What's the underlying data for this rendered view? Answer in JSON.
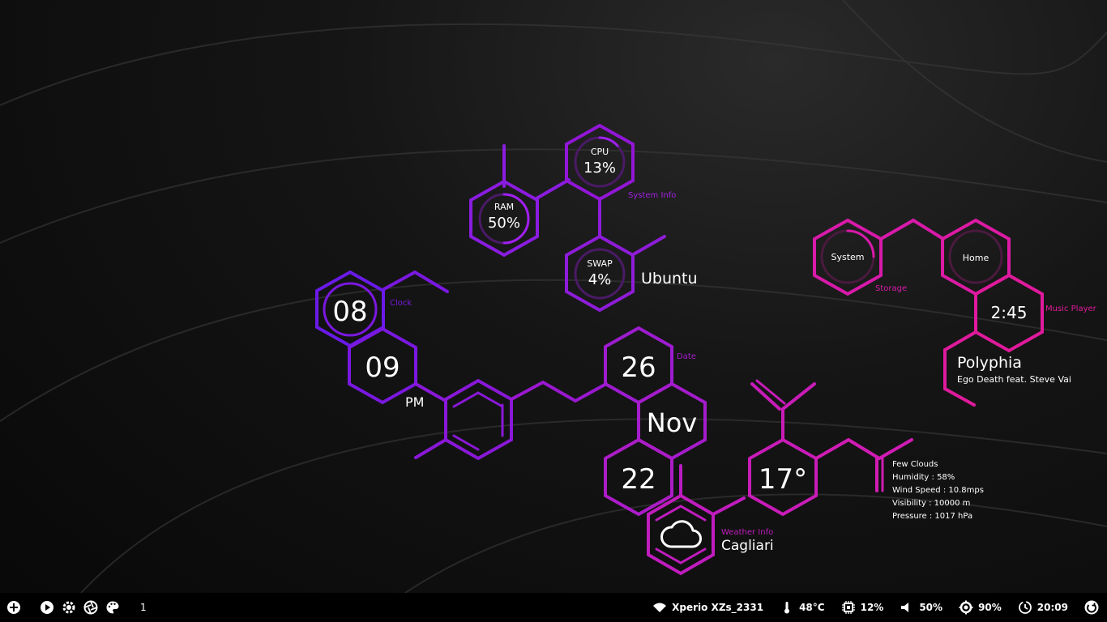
{
  "colors": {
    "purple": "#7a18e0",
    "violet": "#9d1ed6",
    "magenta": "#c91ac4",
    "pink": "#e01a9a",
    "bar": "#000000"
  },
  "system_info": {
    "label": "System Info",
    "cpu": {
      "label": "CPU",
      "value": "13%"
    },
    "ram": {
      "label": "RAM",
      "value": "50%"
    },
    "swap": {
      "label": "SWAP",
      "value": "4%"
    },
    "os": "Ubuntu"
  },
  "clock": {
    "label": "Clock",
    "hour": "08",
    "minute": "09",
    "ampm": "PM"
  },
  "date": {
    "label": "Date",
    "day": "26",
    "month": "Nov",
    "year": "22"
  },
  "weather": {
    "label": "Weather Info",
    "city": "Cagliari",
    "temp": "17°",
    "icon": "cloud-icon",
    "details": [
      "Few Clouds",
      "Humidity : 58%",
      "Wind Speed : 10.8mps",
      "Visibility : 10000 m",
      "Pressure : 1017 hPa"
    ]
  },
  "storage": {
    "label": "Storage",
    "system": "System",
    "home": "Home"
  },
  "music": {
    "label": "Music Player",
    "time": "2:45",
    "artist": "Polyphia",
    "track": "Ego Death feat. Steve Vai"
  },
  "taskbar": {
    "left": [
      "add-icon",
      "play-icon",
      "settings-icon",
      "aperture-icon",
      "palette-icon"
    ],
    "workspace": "1",
    "wifi": "Xperio XZs_2331",
    "temperature": "48°C",
    "cpu": "12%",
    "volume": "50%",
    "brightness": "90%",
    "time": "20:09"
  }
}
